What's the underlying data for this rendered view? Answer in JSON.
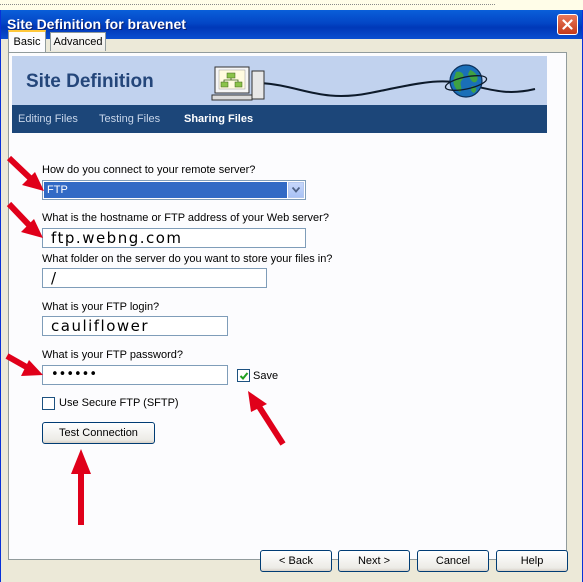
{
  "window": {
    "title": "Site Definition for bravenet"
  },
  "tabs": [
    {
      "label": "Basic"
    },
    {
      "label": "Advanced"
    }
  ],
  "banner": {
    "title": "Site Definition"
  },
  "steps": [
    {
      "label": "Editing Files"
    },
    {
      "label": "Testing Files"
    },
    {
      "label": "Sharing Files"
    }
  ],
  "form": {
    "connect_label": "How do you connect to your remote server?",
    "connect_value": "FTP",
    "host_label": "What is the hostname or FTP address of your Web server?",
    "host_value": "ftp.webng.com",
    "folder_label": "What folder on the server do you want to store your files in?",
    "folder_value": "/",
    "login_label": "What is your FTP login?",
    "login_value": "cauliflower",
    "password_label": "What is your FTP password?",
    "password_value": "••••••",
    "save_label": "Save",
    "sftp_label": "Use Secure FTP (SFTP)",
    "test_button": "Test Connection"
  },
  "footer": {
    "back": "< Back",
    "next": "Next >",
    "cancel": "Cancel",
    "help": "Help"
  },
  "colors": {
    "title_bar": "#0346c6",
    "banner": "#c1d2ee",
    "steps_bar": "#1c4679",
    "selection": "#316ac5",
    "arrows": "#e0001a"
  },
  "icons": [
    "close-icon",
    "computer-network-icon",
    "globe-icon",
    "dropdown-arrow-icon",
    "checkmark-icon"
  ]
}
